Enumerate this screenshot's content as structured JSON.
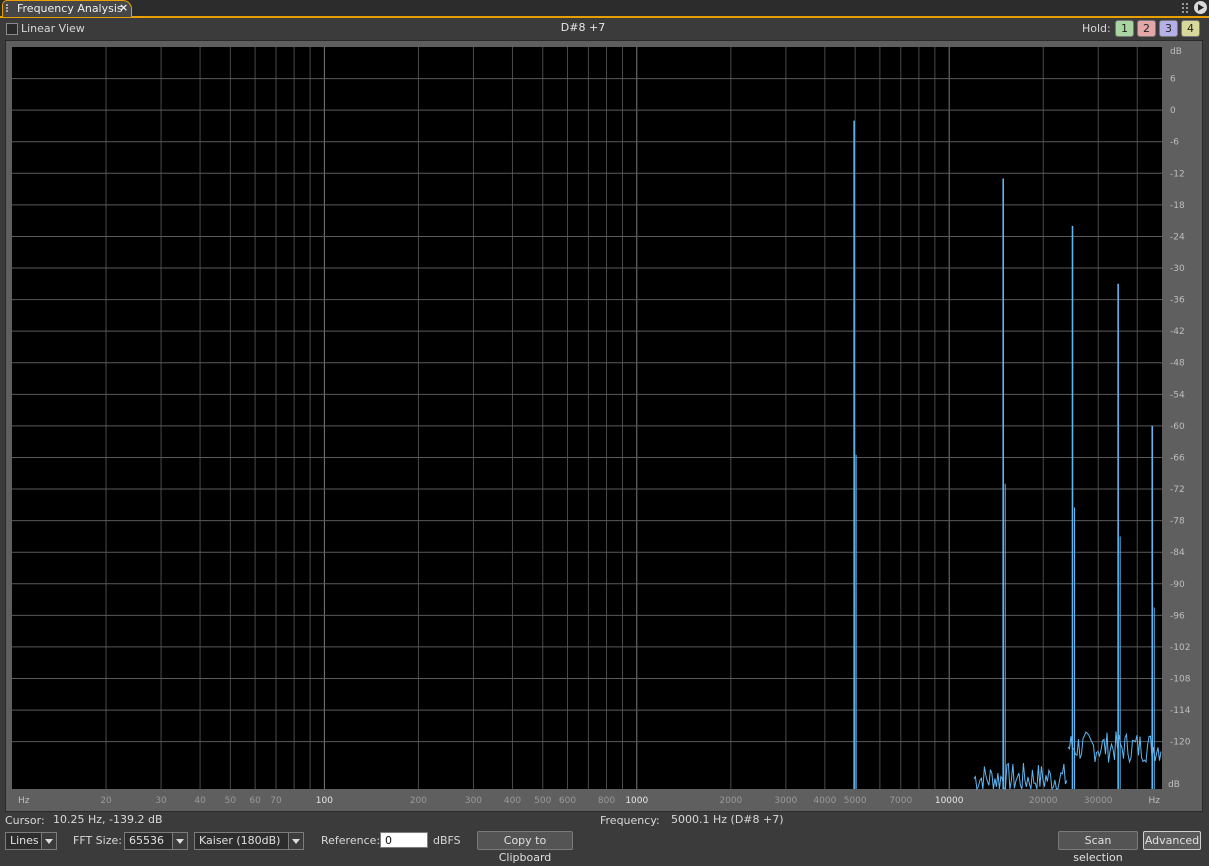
{
  "tab": {
    "title": "Frequency Analysis",
    "close_label": "×"
  },
  "toolbar": {
    "linear_view_label": "Linear View",
    "linear_view_checked": false,
    "note": "D#8 +7",
    "hold_label": "Hold:",
    "hold_buttons": [
      {
        "label": "1",
        "color": "#a9d6a0"
      },
      {
        "label": "2",
        "color": "#e3a7a7"
      },
      {
        "label": "3",
        "color": "#b5b0e6"
      },
      {
        "label": "4",
        "color": "#d8d89a"
      }
    ]
  },
  "chart_data": {
    "type": "line",
    "x_scale": "log",
    "xlim": [
      10,
      48000
    ],
    "ylim": [
      -129,
      12
    ],
    "x_unit_label": "Hz",
    "y_unit_label": "dB",
    "x_major_ticks": [
      100,
      1000,
      10000
    ],
    "x_tick_labels": [
      "20",
      "30",
      "40",
      "50",
      "60",
      "70",
      "100",
      "200",
      "300",
      "400",
      "500",
      "600",
      "800",
      "1000",
      "2000",
      "3000",
      "4000",
      "5000",
      "7000",
      "10000",
      "20000",
      "30000"
    ],
    "y_tick_labels": [
      "6",
      "0",
      "-6",
      "-12",
      "-18",
      "-24",
      "-30",
      "-36",
      "-42",
      "-48",
      "-54",
      "-60",
      "-66",
      "-72",
      "-78",
      "-84",
      "-90",
      "-96",
      "-102",
      "-108",
      "-114",
      "-120"
    ],
    "grid": true,
    "colors": {
      "background": "#000000",
      "grid": "#4a4a4a",
      "spectrum": "#5fb6f0",
      "axis_text": "#bdbdbd"
    },
    "peaks": [
      {
        "freq": 5000,
        "db": -2
      },
      {
        "freq": 15000,
        "db": -13
      },
      {
        "freq": 25000,
        "db": -22
      },
      {
        "freq": 35000,
        "db": -33
      },
      {
        "freq": 45000,
        "db": -60
      }
    ],
    "noise_floor_db": [
      {
        "freq_from": 12000,
        "freq_to": 24000,
        "db": -127
      },
      {
        "freq_from": 24000,
        "freq_to": 48000,
        "db": -121
      }
    ]
  },
  "status": {
    "cursor_label": "Cursor:",
    "cursor_value": "10.25 Hz, -139.2 dB",
    "frequency_label": "Frequency:",
    "frequency_value": "5000.1 Hz (D#8 +7)"
  },
  "controls": {
    "graph_mode": "Lines",
    "fft_size_label": "FFT Size:",
    "fft_size": "65536",
    "window": "Kaiser (180dB)",
    "reference_label": "Reference:",
    "reference_value": "0",
    "reference_unit": "dBFS",
    "copy_label": "Copy to Clipboard",
    "scan_label": "Scan selection",
    "advanced_label": "Advanced"
  }
}
